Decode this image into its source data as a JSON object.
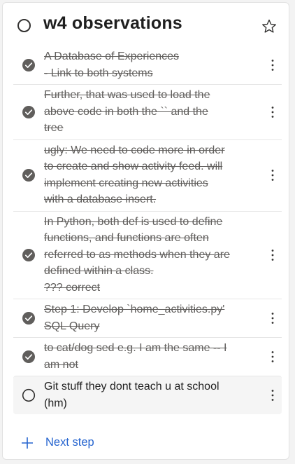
{
  "task": {
    "title": "w4 observations"
  },
  "steps": [
    {
      "text": "A Database of Experiences\n- Link to both systems",
      "completed": true
    },
    {
      "text": "Further, that was used to load the\nabove code in both  the `` and the\ntree",
      "completed": true
    },
    {
      "text": "ugly: We need to code more in order\nto create and show activity feed. will\nimplement creating new activities\nwith a database insert.",
      "completed": true
    },
    {
      "text": "In Python, both def is used to define\nfunctions, and functions are often\nreferred to as methods when they are\ndefined within a class.\n??? correct",
      "completed": true
    },
    {
      "text": "Step 1: Develop `home_activities.py'\nSQL Query",
      "completed": true
    },
    {
      "text": "to cat/dog sed e.g. I am the same -- I\nam not",
      "completed": true
    },
    {
      "text": "Git stuff they dont teach u at school\n(hm)",
      "completed": false
    }
  ],
  "next_step": {
    "label": "Next step"
  },
  "colors": {
    "accent": "#2564cf",
    "check_fill": "#605e5c",
    "strike_text": "#605e5c",
    "text": "#1f1f1f"
  }
}
